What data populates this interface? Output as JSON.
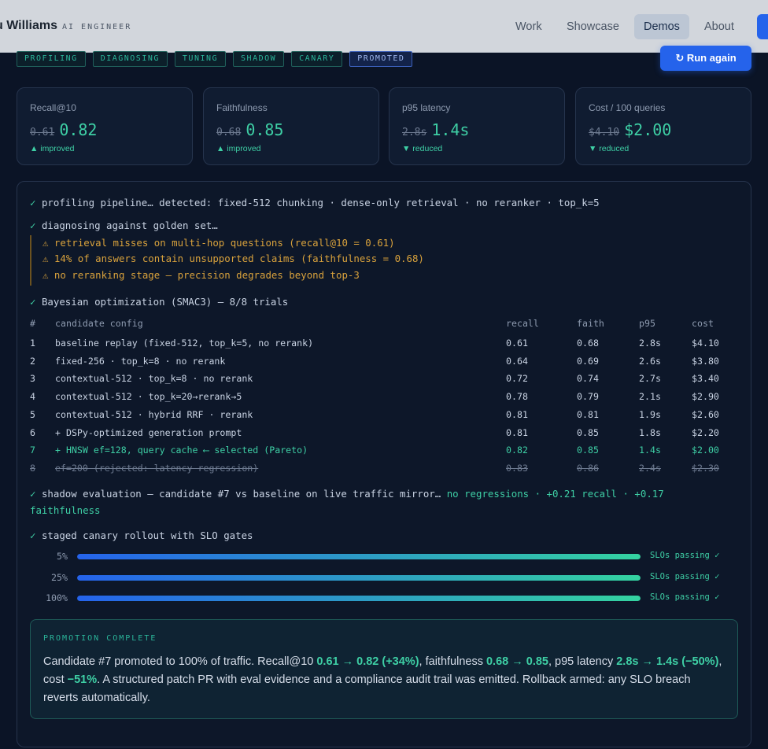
{
  "nav": {
    "brand": "u Williams",
    "brand_sub": "AI ENGINEER",
    "links": [
      "Work",
      "Showcase",
      "Demos",
      "About"
    ],
    "active": "Demos"
  },
  "stages": [
    "PROFILING",
    "DIAGNOSING",
    "TUNING",
    "SHADOW",
    "CANARY",
    "PROMOTED"
  ],
  "run_button": "↻ Run again",
  "metrics": [
    {
      "label": "Recall@10",
      "old": "0.61",
      "new": "0.82",
      "delta": "▲ improved"
    },
    {
      "label": "Faithfulness",
      "old": "0.68",
      "new": "0.85",
      "delta": "▲ improved"
    },
    {
      "label": "p95 latency",
      "old": "2.8s",
      "new": "1.4s",
      "delta": "▼ reduced"
    },
    {
      "label": "Cost / 100 queries",
      "old": "$4.10",
      "new": "$2.00",
      "delta": "▼ reduced"
    }
  ],
  "log": {
    "profiling": "profiling pipeline… detected: fixed-512 chunking · dense-only retrieval · no reranker · top_k=5",
    "diagnosing": "diagnosing against golden set…",
    "warnings": [
      "⚠ retrieval misses on multi-hop questions (recall@10 = 0.61)",
      "⚠ 14% of answers contain unsupported claims (faithfulness = 0.68)",
      "⚠ no reranking stage — precision degrades beyond top-3"
    ],
    "optimization": "Bayesian optimization (SMAC3) — 8/8 trials",
    "check": "✓"
  },
  "trials": {
    "headers": [
      "#",
      "candidate config",
      "recall",
      "faith",
      "p95",
      "cost"
    ],
    "rows": [
      [
        "1",
        "baseline replay (fixed-512, top_k=5, no rerank)",
        "0.61",
        "0.68",
        "2.8s",
        "$4.10"
      ],
      [
        "2",
        "fixed-256 · top_k=8 · no rerank",
        "0.64",
        "0.69",
        "2.6s",
        "$3.80"
      ],
      [
        "3",
        "contextual-512 · top_k=8 · no rerank",
        "0.72",
        "0.74",
        "2.7s",
        "$3.40"
      ],
      [
        "4",
        "contextual-512 · top_k=20→rerank→5",
        "0.78",
        "0.79",
        "2.1s",
        "$2.90"
      ],
      [
        "5",
        "contextual-512 · hybrid RRF · rerank",
        "0.81",
        "0.81",
        "1.9s",
        "$2.60"
      ],
      [
        "6",
        "+ DSPy-optimized generation prompt",
        "0.81",
        "0.85",
        "1.8s",
        "$2.20"
      ],
      [
        "7",
        "+ HNSW ef=128, query cache ⟵ selected (Pareto)",
        "0.82",
        "0.85",
        "1.4s",
        "$2.00"
      ],
      [
        "8",
        "ef=200 (rejected: latency regression)",
        "0.83",
        "0.86",
        "2.4s",
        "$2.30"
      ]
    ],
    "selected_index": 6,
    "rejected_index": 7
  },
  "shadow": {
    "text": "shadow evaluation — candidate #7 vs baseline on live traffic mirror…",
    "result": "no regressions · +0.21 recall · +0.17 faithfulness"
  },
  "canary": {
    "title": "staged canary rollout with SLO gates",
    "steps": [
      {
        "pct": "5%",
        "fill": 1.0,
        "status": "SLOs passing ✓"
      },
      {
        "pct": "25%",
        "fill": 1.0,
        "status": "SLOs passing ✓"
      },
      {
        "pct": "100%",
        "fill": 1.0,
        "status": "SLOs passing ✓"
      }
    ]
  },
  "promotion": {
    "title": "PROMOTION COMPLETE",
    "p1": "Candidate #7 promoted to 100% of traffic. Recall@10 ",
    "h1": "0.61 → 0.82 (+34%)",
    "p2": ", faithfulness ",
    "h2": "0.68 → 0.85",
    "p3": ", p95 latency ",
    "h3": "2.8s → 1.4s (−50%)",
    "p4": ", cost ",
    "h4": "−51%",
    "p5": ". A structured patch PR with eval evidence and a compliance audit trail was emitted. Rollback armed: any SLO breach reverts automatically."
  },
  "colors": {
    "accent": "#2563eb",
    "success": "#3ecfa5",
    "warning": "#d9a23c",
    "background": "#0b1426"
  }
}
